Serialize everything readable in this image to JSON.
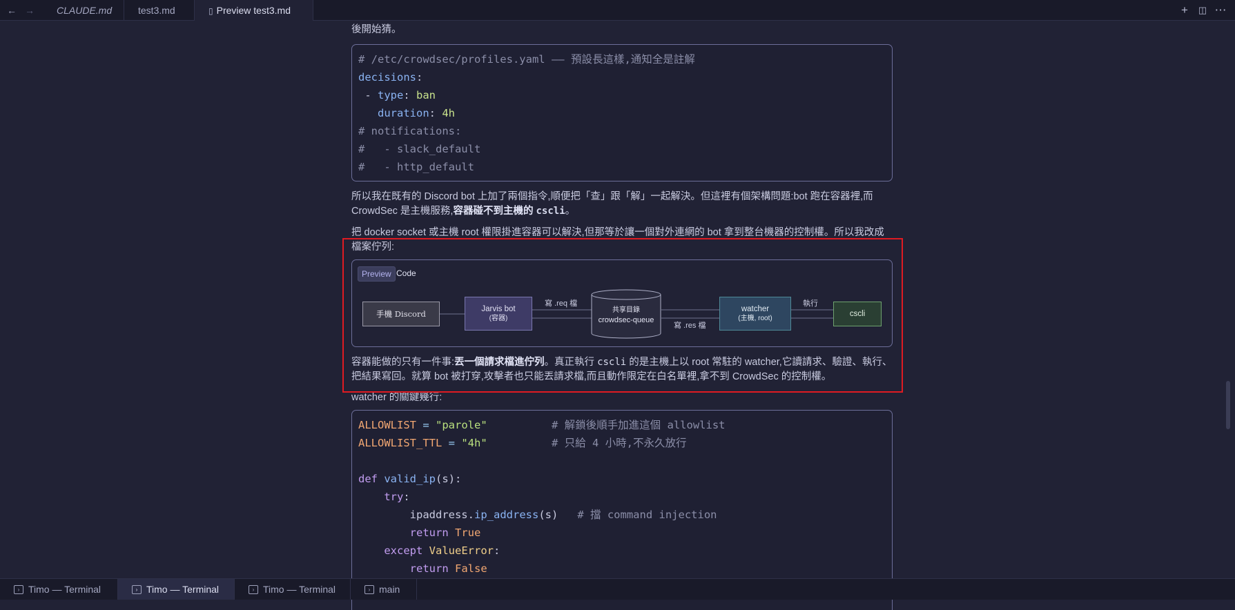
{
  "tabs": [
    {
      "label": "CLAUDE.md"
    },
    {
      "label": "test3.md"
    },
    {
      "label": "Preview test3.md"
    }
  ],
  "doc": {
    "top_line_partial": "後開始猜。",
    "code1": {
      "comment_path": "# /etc/crowdsec/profiles.yaml —— 預設長這樣,通知全是註解",
      "key_decisions": "decisions",
      "key_type": "type",
      "val_ban": "ban",
      "key_duration": "duration",
      "val_duration": "4h",
      "comment_notifications": "# notifications:",
      "comment_slack": "#   - slack_default",
      "comment_http": "#   - http_default"
    },
    "para1": {
      "text_a": "所以我在既有的 Discord bot 上加了兩個指令,順便把「查」跟「解」一起解決。但這裡有個架構問題:bot 跑在容器裡,而 CrowdSec 是主機服務,",
      "bold": "容器碰不到主機的 ",
      "bold_code": "cscli",
      "text_b": "。"
    },
    "para2": "把 docker socket 或主機 root 權限掛進容器可以解決,但那等於讓一個對外連網的 bot 拿到整台機器的控制權。所以我改成檔案佇列:",
    "diagram": {
      "tab_preview": "Preview",
      "tab_code": "Code",
      "node_discord": "手機 Discord",
      "node_jarvis": "Jarvis bot",
      "node_jarvis_sub": "(容器)",
      "node_queue_label": "共享目錄",
      "node_queue": "crowdsec-queue",
      "node_watcher": "watcher",
      "node_watcher_sub": "(主機, root)",
      "node_cscli": "cscli",
      "edge_req": "寫 .req 檔",
      "edge_res": "寫 .res 檔",
      "edge_exec": "執行"
    },
    "para3": {
      "text_a": "容器能做的只有一件事:",
      "bold": "丟一個請求檔進佇列",
      "text_b": "。真正執行 ",
      "code": "cscli",
      "text_c": " 的是主機上以 root 常駐的 watcher,它讀請求、驗證、執行、把結果寫回。就算 bot 被打穿,攻擊者也只能丟請求檔,而且動作限定在白名單裡,拿不到 CrowdSec 的控制權。"
    },
    "para4": "watcher 的關鍵幾行:",
    "code2": {
      "var_allowlist": "ALLOWLIST",
      "val_allowlist": "\"parole\"",
      "comment_allowlist": "# 解鎖後順手加進這個 allowlist",
      "var_ttl": "ALLOWLIST_TTL",
      "val_ttl": "\"4h\"",
      "comment_ttl": "# 只給 4 小時,不永久放行",
      "kw_def": "def",
      "fn_valid_ip": "valid_ip",
      "param_s": "s",
      "kw_try": "try",
      "call_ipaddress": "ipaddress",
      "call_ip_address": "ip_address",
      "comment_injection": "# 擋 command injection",
      "kw_return": "return",
      "val_true": "True",
      "kw_except": "except",
      "cls_valueerror": "ValueError",
      "val_false": "False"
    }
  },
  "terminals": [
    {
      "label": "Timo — Terminal"
    },
    {
      "label": "Timo — Terminal"
    },
    {
      "label": "Timo — Terminal"
    },
    {
      "label": "main"
    }
  ]
}
